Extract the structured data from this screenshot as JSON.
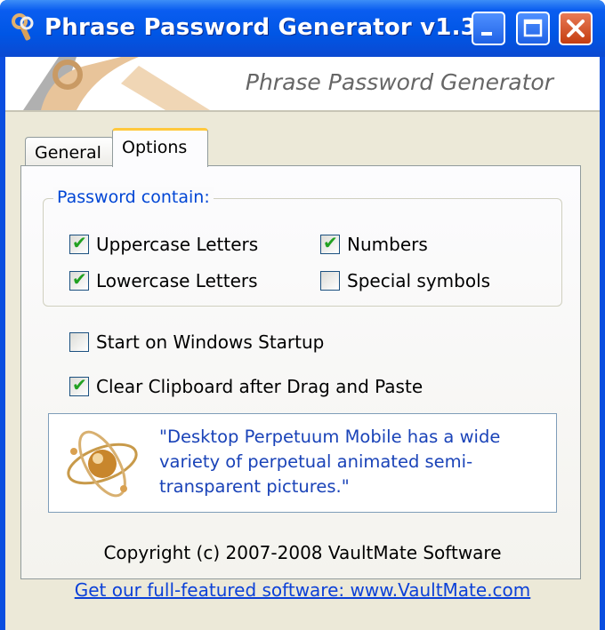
{
  "window": {
    "title": "Phrase Password Generator v1.3",
    "icon": "keys-icon",
    "controls": [
      "minimize",
      "maximize",
      "close"
    ]
  },
  "banner": {
    "title": "Phrase Password Generator"
  },
  "tabs": [
    {
      "label": "General",
      "selected": false
    },
    {
      "label": "Options",
      "selected": true
    }
  ],
  "options": {
    "group_label": "Password contain:",
    "uppercase": {
      "label": "Uppercase Letters",
      "checked": true
    },
    "numbers": {
      "label": "Numbers",
      "checked": true
    },
    "lowercase": {
      "label": "Lowercase Letters",
      "checked": true
    },
    "special": {
      "label": "Special symbols",
      "checked": false
    },
    "startup": {
      "label": "Start on Windows Startup",
      "checked": false
    },
    "clipboard": {
      "label": "Clear Clipboard after Drag and Paste",
      "checked": true
    }
  },
  "ad": {
    "text": "\"Desktop Perpetuum Mobile has a wide variety of perpetual animated semi-transparent pictures.\""
  },
  "footer": {
    "copyright": "Copyright (c) 2007-2008 VaultMate Software",
    "link": "Get our full-featured software: www.VaultMate.com"
  },
  "colors": {
    "titlebar": "#0a5df0",
    "accent_tab": "#ffc83c",
    "link": "#0b40d8",
    "check": "#21a121"
  }
}
